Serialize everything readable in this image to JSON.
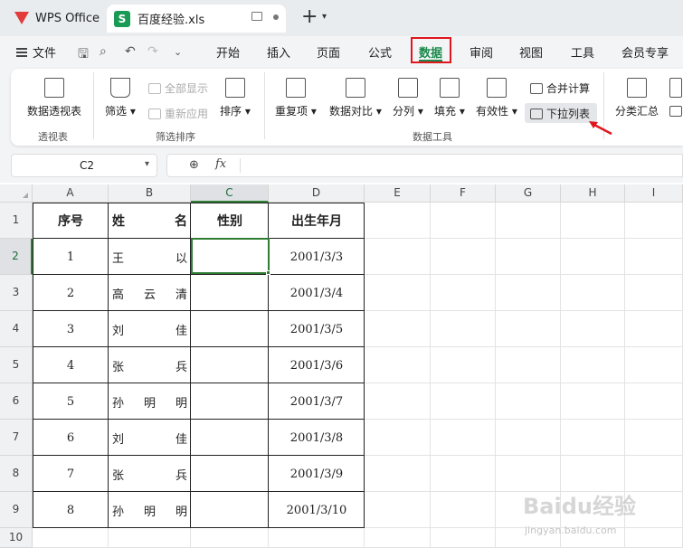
{
  "titlebar": {
    "app_name": "WPS Office",
    "doc_name": "百度经验.xls",
    "new_tab": "+"
  },
  "menu": {
    "file": "文件",
    "items": [
      "开始",
      "插入",
      "页面",
      "公式",
      "数据",
      "审阅",
      "视图",
      "工具",
      "会员专享"
    ],
    "active": "数据"
  },
  "ribbon": {
    "pivot": "数据透视表",
    "filter": "筛选",
    "show_all": "全部显示",
    "reapply": "重新应用",
    "sort": "排序",
    "duplicates": "重复项",
    "compare": "数据对比",
    "split": "分列",
    "fill": "填充",
    "validity": "有效性",
    "consolidate": "合并计算",
    "dropdown_list": "下拉列表",
    "subtotal": "分类汇总",
    "groups": {
      "pivot": "透视表",
      "filter_sort": "筛选排序",
      "data_tools": "数据工具"
    }
  },
  "formula_bar": {
    "cell_ref": "C2",
    "fx": "fx",
    "value": ""
  },
  "grid": {
    "columns": [
      "A",
      "B",
      "C",
      "D",
      "E",
      "F",
      "G",
      "H",
      "I"
    ],
    "rows": [
      "1",
      "2",
      "3",
      "4",
      "5",
      "6",
      "7",
      "8",
      "9",
      "10"
    ],
    "selected_cell": "C2",
    "headers": [
      "序号",
      "姓名",
      "性别",
      "出生年月"
    ],
    "data": [
      {
        "no": "1",
        "name": [
          "王",
          "以"
        ],
        "gender": "",
        "birth": "2001/3/3"
      },
      {
        "no": "2",
        "name": [
          "高",
          "云",
          "清"
        ],
        "gender": "",
        "birth": "2001/3/4"
      },
      {
        "no": "3",
        "name": [
          "刘",
          "佳"
        ],
        "gender": "",
        "birth": "2001/3/5"
      },
      {
        "no": "4",
        "name": [
          "张",
          "兵"
        ],
        "gender": "",
        "birth": "2001/3/6"
      },
      {
        "no": "5",
        "name": [
          "孙",
          "明",
          "明"
        ],
        "gender": "",
        "birth": "2001/3/7"
      },
      {
        "no": "6",
        "name": [
          "刘",
          "佳"
        ],
        "gender": "",
        "birth": "2001/3/8"
      },
      {
        "no": "7",
        "name": [
          "张",
          "兵"
        ],
        "gender": "",
        "birth": "2001/3/9"
      },
      {
        "no": "8",
        "name": [
          "孙",
          "明",
          "明"
        ],
        "gender": "",
        "birth": "2001/3/10"
      }
    ]
  },
  "watermark": {
    "main": "Baidu经验",
    "sub": "jingyan.baidu.com"
  },
  "colors": {
    "accent": "#1a8a4a",
    "highlight_box": "#e0161d",
    "selection": "#2e7d32"
  }
}
